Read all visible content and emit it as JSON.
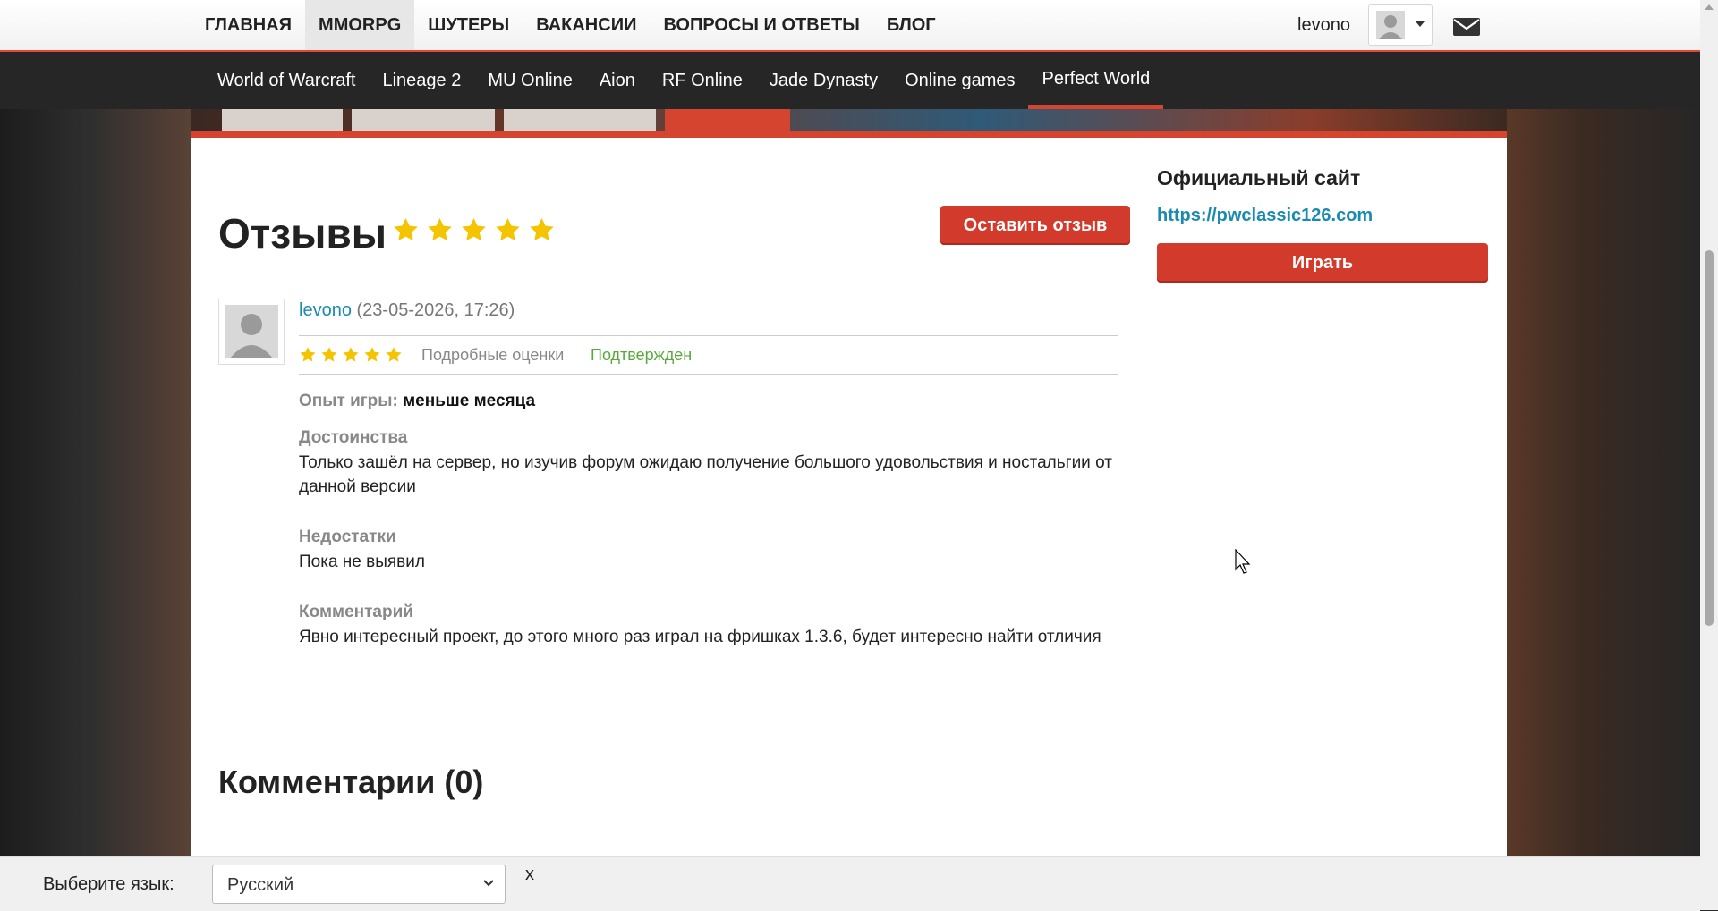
{
  "top_nav": {
    "items": [
      {
        "label": "ГЛАВНАЯ"
      },
      {
        "label": "MMORPG"
      },
      {
        "label": "ШУТЕРЫ"
      },
      {
        "label": "ВАКАНСИИ"
      },
      {
        "label": "ВОПРОСЫ И ОТВЕТЫ"
      },
      {
        "label": "БЛОГ"
      }
    ],
    "active": "MMORPG",
    "username": "levono",
    "user_menu_icon": "user-avatar-icon",
    "messages_icon": "envelope-icon"
  },
  "sub_nav": {
    "items": [
      {
        "label": "World of Warcraft"
      },
      {
        "label": "Lineage 2"
      },
      {
        "label": "MU Online"
      },
      {
        "label": "Aion"
      },
      {
        "label": "RF Online"
      },
      {
        "label": "Jade Dynasty"
      },
      {
        "label": "Online games"
      },
      {
        "label": "Perfect World"
      }
    ],
    "active": "Perfect World"
  },
  "reviews": {
    "title": "Отзывы",
    "rating_stars": 5,
    "leave_review_button": "Оставить отзыв",
    "review": {
      "author": "levono",
      "date": "(23-05-2026, 17:26)",
      "stars": 5,
      "detailed_ratings": "Подробные оценки",
      "status": "Подтвержден",
      "experience_label": "Опыт игры:",
      "experience_value": "меньше месяца",
      "pros_label": "Достоинства",
      "pros_text": "Только зашёл на сервер, но изучив форум ожидаю получение большого удовольствия и ностальгии от данной версии",
      "cons_label": "Недостатки",
      "cons_text": "Пока не выявил",
      "comment_label": "Комментарий",
      "comment_text": "Явно интересный проект, до этого много раз играл на фришках 1.3.6, будет интересно найти отличия"
    },
    "comments_title": "Комментарии (0)"
  },
  "sidebar": {
    "official_site_title": "Официальный сайт",
    "official_site_url": "https://pwclassic126.com",
    "play_button": "Играть"
  },
  "language_bar": {
    "label": "Выберите язык:",
    "selected": "Русский",
    "close": "x"
  },
  "colors": {
    "accent_red": "#d23a2c",
    "link_blue": "#1a8bb0",
    "confirmed_green": "#5aa83c",
    "star_yellow": "#f5c400"
  }
}
